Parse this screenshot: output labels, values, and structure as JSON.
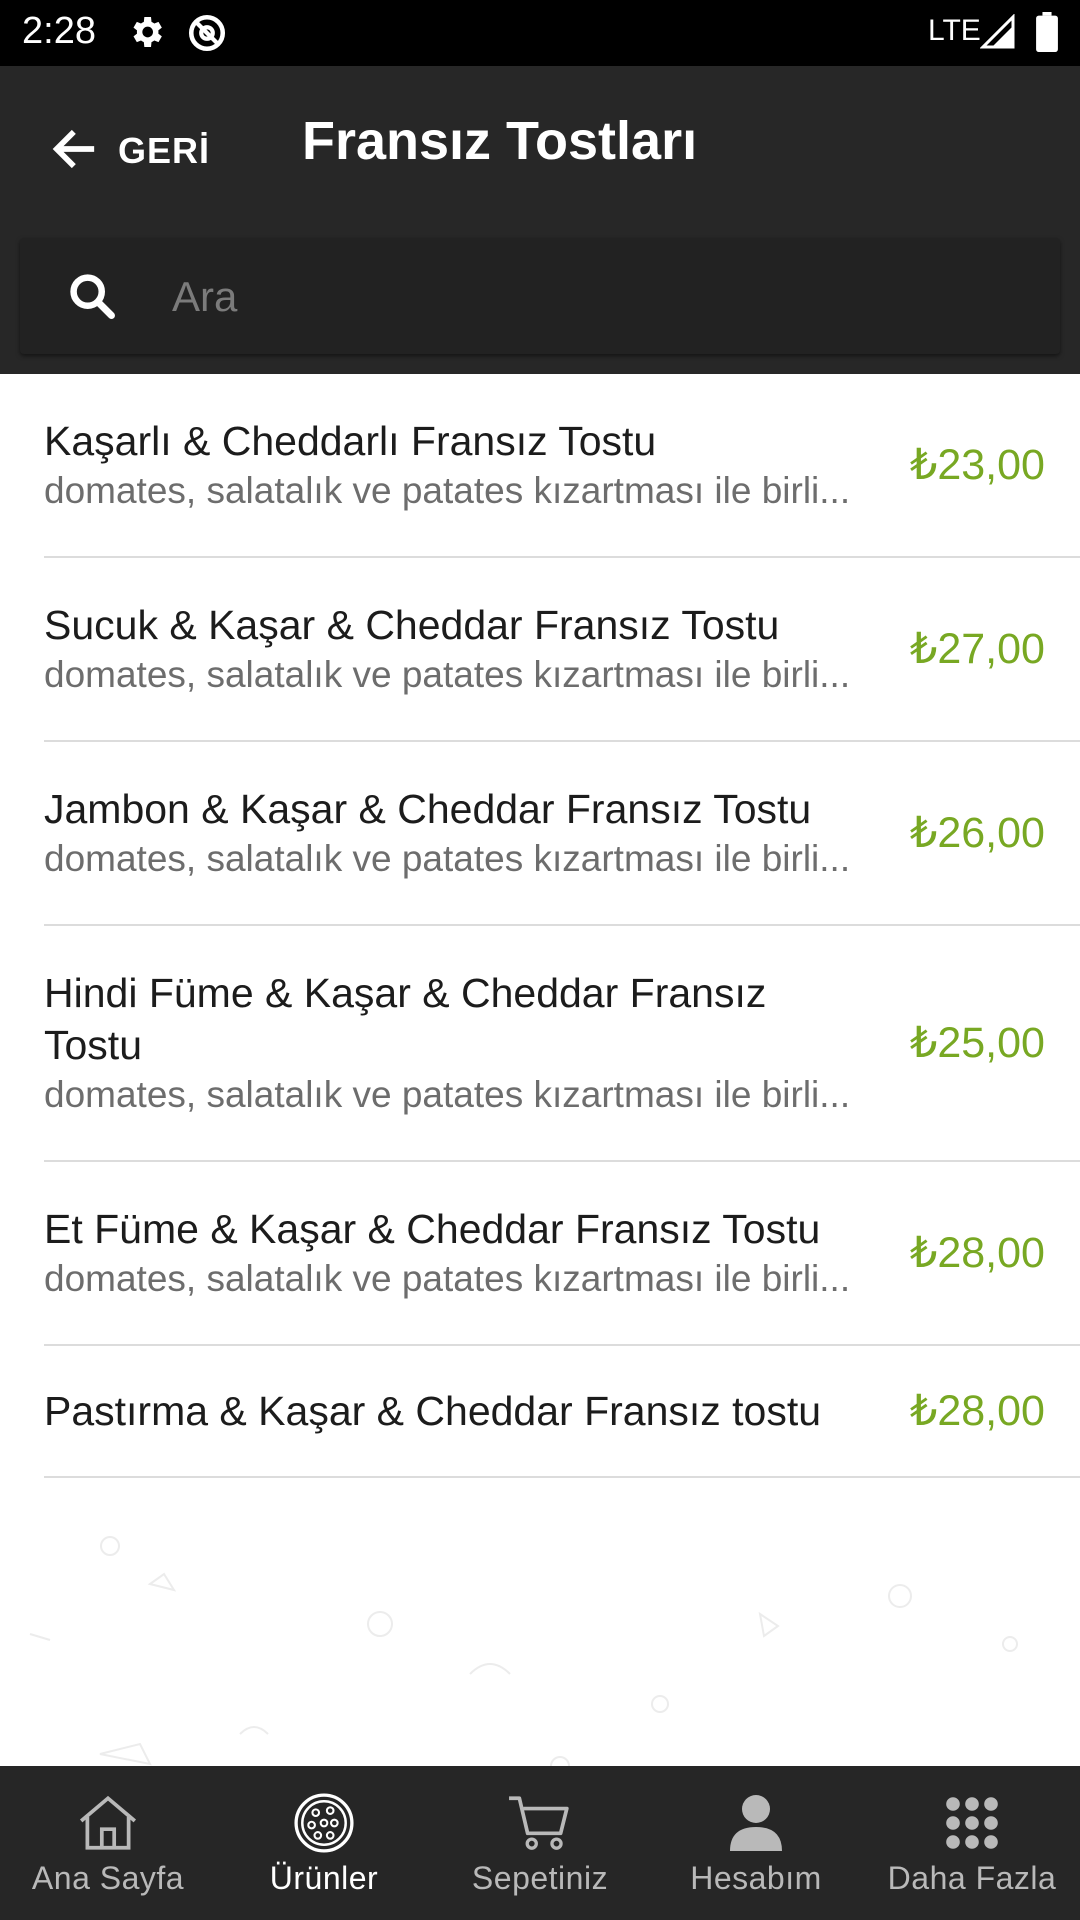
{
  "status_bar": {
    "time": "2:28",
    "network": "LTE"
  },
  "header": {
    "back_label": "GERİ",
    "title": "Fransız Tostları"
  },
  "search": {
    "placeholder": "Ara",
    "value": ""
  },
  "products": [
    {
      "name": "Kaşarlı & Cheddarlı Fransız Tostu",
      "description": "domates, salatalık ve patates kızartması ile birli...",
      "price": "₺23,00"
    },
    {
      "name": "Sucuk & Kaşar & Cheddar Fransız Tostu",
      "description": "domates, salatalık ve patates kızartması ile birli...",
      "price": "₺27,00"
    },
    {
      "name": "Jambon & Kaşar & Cheddar Fransız Tostu",
      "description": "domates, salatalık ve patates kızartması ile birli...",
      "price": "₺26,00"
    },
    {
      "name": "Hindi Füme & Kaşar & Cheddar Fransız Tostu",
      "description": "domates, salatalık ve patates kızartması ile birli...",
      "price": "₺25,00"
    },
    {
      "name": "Et Füme & Kaşar & Cheddar Fransız Tostu",
      "description": "domates, salatalık ve patates kızartması ile birli...",
      "price": "₺28,00"
    },
    {
      "name": "Pastırma & Kaşar & Cheddar Fransız tostu",
      "description": "",
      "price": "₺28,00"
    }
  ],
  "bottom_nav": [
    {
      "label": "Ana Sayfa",
      "icon": "home-icon",
      "active": false
    },
    {
      "label": "Ürünler",
      "icon": "pizza-icon",
      "active": true
    },
    {
      "label": "Sepetiniz",
      "icon": "cart-icon",
      "active": false
    },
    {
      "label": "Hesabım",
      "icon": "account-icon",
      "active": false
    },
    {
      "label": "Daha Fazla",
      "icon": "more-grid-icon",
      "active": false
    }
  ],
  "colors": {
    "header_bg": "#272727",
    "price": "#78a823",
    "nav_bg": "#262626",
    "nav_active": "#ffffff",
    "nav_inactive": "#b9b9b9"
  }
}
